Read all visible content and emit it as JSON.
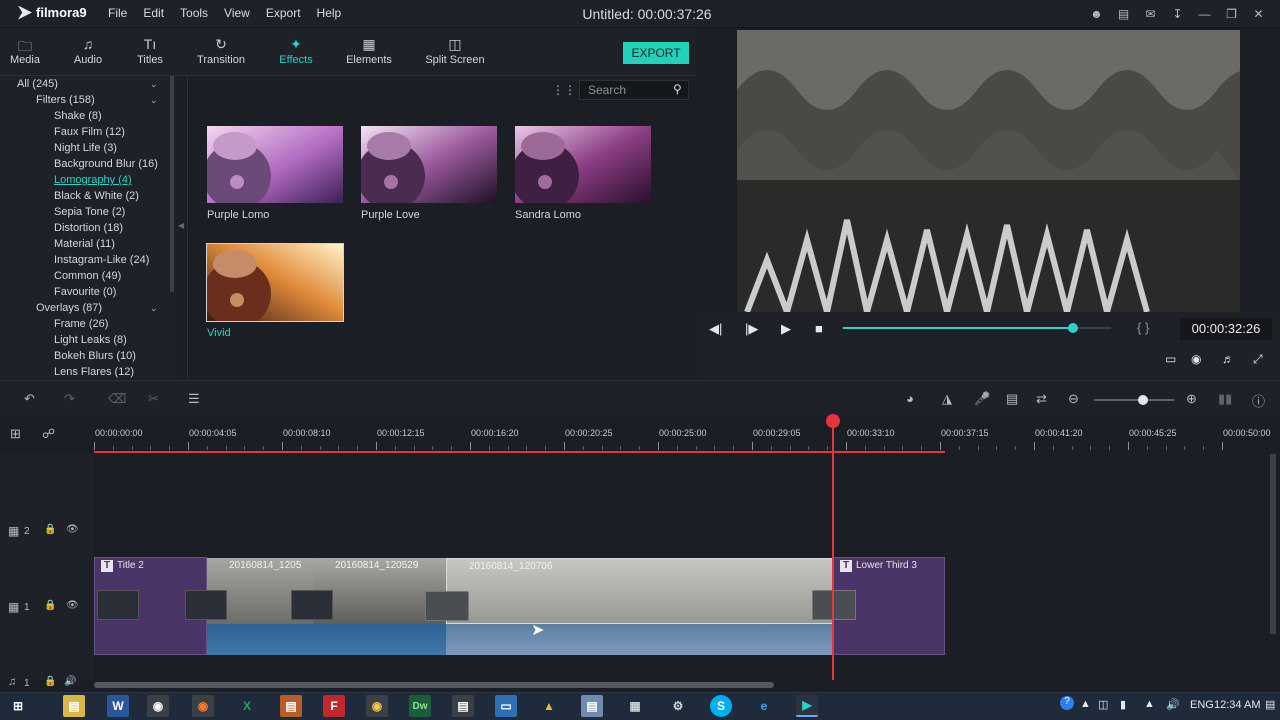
{
  "app": {
    "name": "filmora9",
    "window_title": "Untitled: 00:00:37:26",
    "menus": [
      "File",
      "Edit",
      "Tools",
      "View",
      "Export",
      "Help"
    ]
  },
  "tabs": [
    {
      "label": "Media",
      "icon": "folder-icon"
    },
    {
      "label": "Audio",
      "icon": "music-note-icon"
    },
    {
      "label": "Titles",
      "icon": "titles-icon"
    },
    {
      "label": "Transition",
      "icon": "transition-icon"
    },
    {
      "label": "Effects",
      "icon": "effects-icon",
      "active": true
    },
    {
      "label": "Elements",
      "icon": "elements-icon"
    },
    {
      "label": "Split Screen",
      "icon": "split-screen-icon"
    }
  ],
  "export_label": "EXPORT",
  "library": {
    "items": [
      {
        "label": "All (245)",
        "level": 0,
        "expanded": true
      },
      {
        "label": "Filters (158)",
        "level": 1,
        "expanded": true
      },
      {
        "label": "Shake (8)",
        "level": 2
      },
      {
        "label": "Faux Film (12)",
        "level": 2
      },
      {
        "label": "Night Life (3)",
        "level": 2
      },
      {
        "label": "Background Blur (16)",
        "level": 2
      },
      {
        "label": "Lomography (4)",
        "level": 2,
        "selected": true
      },
      {
        "label": "Black & White (2)",
        "level": 2
      },
      {
        "label": "Sepia Tone (2)",
        "level": 2
      },
      {
        "label": "Distortion (18)",
        "level": 2
      },
      {
        "label": "Material (11)",
        "level": 2
      },
      {
        "label": "Instagram-Like (24)",
        "level": 2
      },
      {
        "label": "Common (49)",
        "level": 2
      },
      {
        "label": "Favourite (0)",
        "level": 2
      },
      {
        "label": "Overlays (87)",
        "level": 1,
        "expanded": true
      },
      {
        "label": "Frame (26)",
        "level": 2
      },
      {
        "label": "Light Leaks (8)",
        "level": 2
      },
      {
        "label": "Bokeh Blurs (10)",
        "level": 2
      },
      {
        "label": "Lens Flares (12)",
        "level": 2
      }
    ]
  },
  "search": {
    "placeholder": "Search"
  },
  "effects": [
    {
      "label": "Purple Lomo"
    },
    {
      "label": "Purple Love"
    },
    {
      "label": "Sandra Lomo"
    },
    {
      "label": "Vivid",
      "selected": true
    }
  ],
  "player": {
    "timecode": "00:00:32:26",
    "progress": 0.86
  },
  "timeline": {
    "ruler_ticks": [
      "00:00:00:00",
      "00:00:04:05",
      "00:00:08:10",
      "00:00:12:15",
      "00:00:16:20",
      "00:00:20:25",
      "00:00:25:00",
      "00:00:29:05",
      "00:00:33:10",
      "00:00:37:15",
      "00:00:41:20",
      "00:00:45:25",
      "00:00:50:00"
    ],
    "tracks": [
      {
        "label": "2",
        "type": "video"
      },
      {
        "label": "1",
        "type": "video"
      },
      {
        "label": "1",
        "type": "audio"
      }
    ],
    "clips": {
      "title_left": "Title 2",
      "video1": "20160814_1205",
      "video2": "20160814_120529",
      "video3": "20160814_120706",
      "title_right": "Lower Third 3"
    }
  },
  "taskbar": {
    "language": "ENG",
    "time": "12:34 AM"
  },
  "colors": {
    "accent": "#2ad3c6",
    "export_button": "#22d1b9",
    "playhead": "#e8343c",
    "title_clip": "#4b3468",
    "audio_clip": "#3b6d9c"
  }
}
